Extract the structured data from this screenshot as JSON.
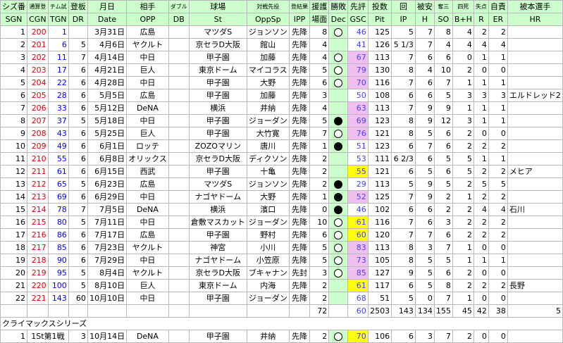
{
  "headers": [
    "シズ番",
    "通算登",
    "チム試",
    "登板",
    "月日",
    "相手",
    "ダブル",
    "球場",
    "対戦先投",
    "登結果",
    "援護",
    "勝敗",
    "先評",
    "投数",
    "回",
    "被安",
    "奪三",
    "四死",
    "失点",
    "自責",
    "被本選手"
  ],
  "headers2": [
    "SGN",
    "CGN",
    "TGN",
    "DR",
    "Date",
    "OPP",
    "DB",
    "St",
    "OppSp",
    "IPP",
    "場面",
    "Dec",
    "GSC",
    "Pit",
    "IP",
    "H",
    "SO",
    "B+H",
    "R",
    "ER",
    "HR"
  ],
  "colors": {
    "header_bg": "#ccffcc",
    "gsc_purple": "#f2bff2",
    "gsc_yellow": "#ffff00",
    "dec_bg": "#ccffcc",
    "grid": "#b8b8b8",
    "cgn_red": "#e00000",
    "tgn_blue": "#0000ff"
  },
  "rows": [
    {
      "sgn": "1",
      "cgn": "200",
      "tgn": "1",
      "dr": "",
      "date": "3月31日",
      "opp": "広島",
      "db": "",
      "st": "マツダS",
      "oppsp": "ジョンソン",
      "ipp": "先降",
      "sc": "8",
      "dec": "W",
      "gsc": "46",
      "gc": "",
      "pit": "125",
      "ip": "5",
      "h": "7",
      "so": "8",
      "bh": "4",
      "r": "2",
      "er": "2",
      "hr": ""
    },
    {
      "sgn": "2",
      "cgn": "201",
      "tgn": "6",
      "dr": "5",
      "date": "4月6日",
      "opp": "ヤクルト",
      "db": "",
      "st": "京セラD大阪",
      "oppsp": "館山",
      "ipp": "先降",
      "sc": "4",
      "dec": "",
      "gsc": "41",
      "gc": "",
      "pit": "126",
      "ip": "5 1/3",
      "h": "7",
      "so": "4",
      "bh": "4",
      "r": "4",
      "er": "4",
      "hr": ""
    },
    {
      "sgn": "3",
      "cgn": "202",
      "tgn": "11",
      "dr": "7",
      "date": "4月14日",
      "opp": "中日",
      "db": "",
      "st": "甲子園",
      "oppsp": "加藤",
      "ipp": "先降",
      "sc": "4",
      "dec": "W",
      "gsc": "67",
      "gc": "p",
      "pit": "113",
      "ip": "7",
      "h": "6",
      "so": "6",
      "bh": "0",
      "r": "1",
      "er": "1",
      "hr": ""
    },
    {
      "sgn": "4",
      "cgn": "203",
      "tgn": "17",
      "dr": "6",
      "date": "4月21日",
      "opp": "巨人",
      "db": "",
      "st": "東京ドーム",
      "oppsp": "マイコラス",
      "ipp": "先降",
      "sc": "5",
      "dec": "W",
      "gsc": "79",
      "gc": "p",
      "pit": "130",
      "ip": "8",
      "h": "4",
      "so": "10",
      "bh": "2",
      "r": "0",
      "er": "0",
      "hr": ""
    },
    {
      "sgn": "5",
      "cgn": "204",
      "tgn": "22",
      "dr": "6",
      "date": "4月28日",
      "opp": "中日",
      "db": "",
      "st": "甲子園",
      "oppsp": "大野",
      "ipp": "先降",
      "sc": "6",
      "dec": "W",
      "gsc": "70",
      "gc": "p",
      "pit": "116",
      "ip": "7",
      "h": "6",
      "so": "7",
      "bh": "1",
      "r": "1",
      "er": "1",
      "hr": ""
    },
    {
      "sgn": "6",
      "cgn": "205",
      "tgn": "28",
      "dr": "6",
      "date": "5月5日",
      "opp": "広島",
      "db": "",
      "st": "甲子園",
      "oppsp": "加藤",
      "ipp": "先降",
      "sc": "3",
      "dec": "",
      "gsc": "50",
      "gc": "",
      "pit": "108",
      "ip": "6",
      "h": "6",
      "so": "5",
      "bh": "3",
      "r": "3",
      "er": "3",
      "hr": "エルドレッド2"
    },
    {
      "sgn": "7",
      "cgn": "206",
      "tgn": "33",
      "dr": "6",
      "date": "5月12日",
      "opp": "DeNA",
      "db": "",
      "st": "横浜",
      "oppsp": "井納",
      "ipp": "先降",
      "sc": "4",
      "dec": "",
      "gsc": "63",
      "gc": "p",
      "pit": "113",
      "ip": "7",
      "h": "9",
      "so": "9",
      "bh": "1",
      "r": "1",
      "er": "1",
      "hr": ""
    },
    {
      "sgn": "8",
      "cgn": "207",
      "tgn": "37",
      "dr": "5",
      "date": "5月18日",
      "opp": "中日",
      "db": "",
      "st": "甲子園",
      "oppsp": "ジョーダン",
      "ipp": "先降",
      "sc": "5",
      "dec": "L",
      "gsc": "69",
      "gc": "p",
      "pit": "123",
      "ip": "8",
      "h": "9",
      "so": "12",
      "bh": "3",
      "r": "1",
      "er": "1",
      "hr": ""
    },
    {
      "sgn": "9",
      "cgn": "208",
      "tgn": "43",
      "dr": "6",
      "date": "5月25日",
      "opp": "巨人",
      "db": "",
      "st": "甲子園",
      "oppsp": "大竹寛",
      "ipp": "先降",
      "sc": "7",
      "dec": "W",
      "gsc": "76",
      "gc": "p",
      "pit": "121",
      "ip": "8",
      "h": "5",
      "so": "6",
      "bh": "2",
      "r": "0",
      "er": "0",
      "hr": ""
    },
    {
      "sgn": "10",
      "cgn": "209",
      "tgn": "49",
      "dr": "6",
      "date": "6月1日",
      "opp": "ロッテ",
      "db": "",
      "st": "ZOZOマリン",
      "oppsp": "唐川",
      "ipp": "先降",
      "sc": "1",
      "dec": "L",
      "gsc": "51",
      "gc": "",
      "pit": "123",
      "ip": "6",
      "h": "7",
      "so": "6",
      "bh": "2",
      "r": "2",
      "er": "2",
      "hr": ""
    },
    {
      "sgn": "11",
      "cgn": "210",
      "tgn": "55",
      "dr": "6",
      "date": "6月8日",
      "opp": "オリックス",
      "db": "",
      "st": "京セラD大阪",
      "oppsp": "ディクソン",
      "ipp": "先降",
      "sc": "2",
      "dec": "",
      "gsc": "53",
      "gc": "",
      "pit": "111",
      "ip": "6 2/3",
      "h": "6",
      "so": "5",
      "bh": "5",
      "r": "1",
      "er": "1",
      "hr": ""
    },
    {
      "sgn": "12",
      "cgn": "211",
      "tgn": "61",
      "dr": "6",
      "date": "6月15日",
      "opp": "西武",
      "db": "",
      "st": "甲子園",
      "oppsp": "十亀",
      "ipp": "先降",
      "sc": "2",
      "dec": "",
      "gsc": "55",
      "gc": "y",
      "pit": "121",
      "ip": "6",
      "h": "5",
      "so": "6",
      "bh": "5",
      "r": "2",
      "er": "2",
      "hr": "メヒア"
    },
    {
      "sgn": "13",
      "cgn": "212",
      "tgn": "65",
      "dr": "5",
      "date": "6月23日",
      "opp": "広島",
      "db": "",
      "st": "マツダS",
      "oppsp": "ジョンソン",
      "ipp": "先降",
      "sc": "2",
      "dec": "L",
      "gsc": "29",
      "gc": "",
      "pit": "113",
      "ip": "5",
      "h": "9",
      "so": "5",
      "bh": "2",
      "r": "5",
      "er": "5",
      "hr": ""
    },
    {
      "sgn": "14",
      "cgn": "213",
      "tgn": "69",
      "dr": "6",
      "date": "6月29日",
      "opp": "中日",
      "db": "",
      "st": "ナゴヤドーム",
      "oppsp": "大野",
      "ipp": "先降",
      "sc": "1",
      "dec": "L",
      "gsc": "52",
      "gc": "p",
      "pit": "125",
      "ip": "7",
      "h": "9",
      "so": "2",
      "bh": "1",
      "r": "2",
      "er": "2",
      "hr": ""
    },
    {
      "sgn": "15",
      "cgn": "214",
      "tgn": "78",
      "dr": "7",
      "date": "7月5日",
      "opp": "DeNA",
      "db": "",
      "st": "横浜",
      "oppsp": "濱口",
      "ipp": "先降",
      "sc": "0",
      "dec": "L",
      "gsc": "46",
      "gc": "",
      "pit": "102",
      "ip": "6",
      "h": "6",
      "so": "2",
      "bh": "2",
      "r": "4",
      "er": "4",
      "hr": "石川"
    },
    {
      "sgn": "16",
      "cgn": "215",
      "tgn": "80",
      "dr": "5",
      "date": "7月11日",
      "opp": "中日",
      "db": "",
      "st": "倉敷マスカット",
      "oppsp": "ジョーダン",
      "ipp": "先降",
      "sc": "10",
      "dec": "W",
      "gsc": "61",
      "gc": "y",
      "pit": "116",
      "ip": "7",
      "h": "6",
      "so": "3",
      "bh": "2",
      "r": "2",
      "er": "2",
      "hr": ""
    },
    {
      "sgn": "17",
      "cgn": "216",
      "tgn": "86",
      "dr": "6",
      "date": "7月17日",
      "opp": "広島",
      "db": "",
      "st": "甲子園",
      "oppsp": "野村",
      "ipp": "先降",
      "sc": "6",
      "dec": "W",
      "gsc": "60",
      "gc": "y",
      "pit": "120",
      "ip": "7",
      "h": "7",
      "so": "6",
      "bh": "2",
      "r": "2",
      "er": "2",
      "hr": ""
    },
    {
      "sgn": "18",
      "cgn": "217",
      "tgn": "85",
      "dr": "6",
      "date": "7月23日",
      "opp": "ヤクルト",
      "db": "",
      "st": "神宮",
      "oppsp": "小川",
      "ipp": "先降",
      "sc": "5",
      "dec": "W",
      "gsc": "83",
      "gc": "p",
      "pit": "113",
      "ip": "8",
      "h": "3",
      "so": "7",
      "bh": "1",
      "r": "0",
      "er": "0",
      "hr": ""
    },
    {
      "sgn": "19",
      "cgn": "218",
      "tgn": "90",
      "dr": "6",
      "date": "7月29日",
      "opp": "中日",
      "db": "",
      "st": "ナゴヤドーム",
      "oppsp": "小笠原",
      "ipp": "先降",
      "sc": "5",
      "dec": "W",
      "gsc": "73",
      "gc": "p",
      "pit": "105",
      "ip": "8",
      "h": "5",
      "so": "5",
      "bh": "1",
      "r": "1",
      "er": "1",
      "hr": ""
    },
    {
      "sgn": "20",
      "cgn": "219",
      "tgn": "95",
      "dr": "5",
      "date": "8月4日",
      "opp": "ヤクルト",
      "db": "",
      "st": "京セラD大阪",
      "oppsp": "ブキャナン",
      "ipp": "先封",
      "sc": "3",
      "dec": "W",
      "gsc": "85",
      "gc": "p",
      "pit": "127",
      "ip": "9",
      "h": "5",
      "so": "6",
      "bh": "2",
      "r": "0",
      "er": "0",
      "hr": ""
    },
    {
      "sgn": "21",
      "cgn": "220",
      "tgn": "100",
      "dr": "5",
      "date": "8月10日",
      "opp": "巨人",
      "db": "",
      "st": "東京ドーム",
      "oppsp": "内海",
      "ipp": "先降",
      "sc": "2",
      "dec": "",
      "gsc": "61",
      "gc": "y",
      "pit": "117",
      "ip": "6",
      "h": "5",
      "so": "8",
      "bh": "2",
      "r": "2",
      "er": "2",
      "hr": "長野"
    },
    {
      "sgn": "22",
      "cgn": "221",
      "tgn": "143",
      "dr": "60",
      "date": "10月10日",
      "opp": "中日",
      "db": "",
      "st": "甲子園",
      "oppsp": "ジョーダン",
      "ipp": "先降",
      "sc": "2",
      "dec": "",
      "gsc": "68",
      "gc": "",
      "pit": "51",
      "ip": "5",
      "h": "0",
      "so": "7",
      "bh": "1",
      "r": "0",
      "er": "0",
      "hr": ""
    }
  ],
  "totals": {
    "sc": "72",
    "gsc": "60",
    "pit": "2503",
    "ip": "143",
    "h": "134",
    "so": "155",
    "bh": "45",
    "r": "42",
    "er": "38",
    "hr": "5"
  },
  "section_title": "クライマックスシリーズ",
  "cs_row": {
    "sgn": "1",
    "cgn": "1St第1戦",
    "dr": "3",
    "date": "10月14日",
    "opp": "DeNA",
    "st": "甲子園",
    "oppsp": "井納",
    "ipp": "先降",
    "sc": "2",
    "dec": "W",
    "gsc": "70",
    "gc": "y",
    "pit": "106",
    "ip": "6",
    "h": "3",
    "so": "7",
    "bh": "2",
    "r": "0",
    "er": "0"
  }
}
